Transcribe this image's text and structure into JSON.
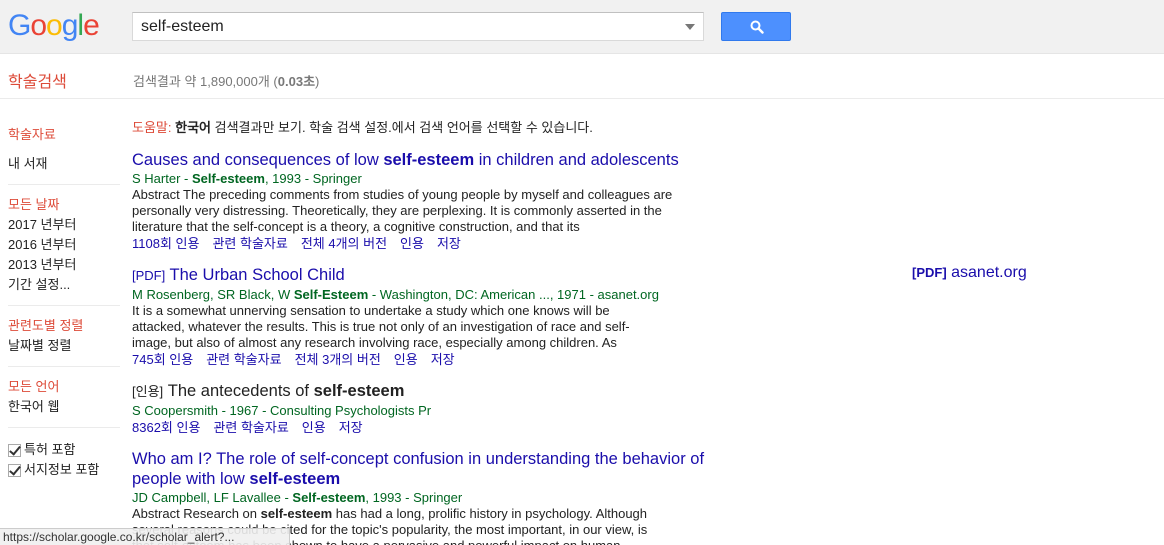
{
  "logo": {
    "letters": [
      {
        "ch": "G",
        "color": "#4285f4"
      },
      {
        "ch": "o",
        "color": "#ea4335"
      },
      {
        "ch": "o",
        "color": "#fbbc05"
      },
      {
        "ch": "g",
        "color": "#4285f4"
      },
      {
        "ch": "l",
        "color": "#34a853"
      },
      {
        "ch": "e",
        "color": "#ea4335"
      }
    ]
  },
  "search": {
    "value": "self-esteem",
    "button_icon": "search-icon"
  },
  "header": {
    "scholar_title": "학술검색",
    "stats_prefix": "검색결과 약 1,890,000개 (",
    "stats_time": "0.03초",
    "stats_suffix": ")"
  },
  "sidebar": {
    "articles": "학술자료",
    "my_library": "내 서재",
    "any_time": "모든 날짜",
    "since_2017": "2017 년부터",
    "since_2016": "2016 년부터",
    "since_2013": "2013 년부터",
    "custom_range": "기간 설정...",
    "sort_relevance": "관련도별 정렬",
    "sort_date": "날짜별 정렬",
    "any_language": "모든 언어",
    "korean_web": "한국어 웹",
    "include_patents": "특허 포함",
    "include_citations": "서지정보 포함"
  },
  "help": {
    "label": "도움말:",
    "lang": "한국어",
    "text": " 검색결과만 보기. 학술 검색 설정.에서 검색 언어를 선택할 수 있습니다."
  },
  "results": [
    {
      "title_pre": "Causes and consequences of low ",
      "title_bold": "self-esteem",
      "title_post": " in children and adolescents",
      "meta_pre": "S Harter - ",
      "meta_bold": "Self-esteem",
      "meta_post": ", 1993 - Springer",
      "snippet": "Abstract The preceding comments from studies of young people by myself and colleagues are personally very distressing. Theoretically, they are perplexing. It is commonly asserted in the literature that the self-concept is a theory, a cognitive construction, and that its",
      "cited": "1108회 인용",
      "related": "관련 학술자료",
      "versions": "전체 4개의 버전",
      "cite": "인용",
      "save": "저장"
    },
    {
      "tag": "[PDF]",
      "title": "The Urban School Child",
      "meta_pre": "M Rosenberg, SR Black, W ",
      "meta_bold": "Self-Esteem",
      "meta_post": " - Washington, DC: American ..., 1971 - asanet.org",
      "snippet": "It is a somewhat unnerving sensation to undertake a study which one knows will be attacked, whatever the results. This is true not only of an investigation of race and self-image, but also of almost any research involving race, especially among children. As",
      "cited": "745회 인용",
      "related": "관련 학술자료",
      "versions": "전체 3개의 버전",
      "cite": "인용",
      "save": "저장",
      "side_tag": "[PDF]",
      "side_domain": "asanet.org"
    },
    {
      "tag": "[인용]",
      "title_pre": "The antecedents of ",
      "title_bold": "self-esteem",
      "meta": "S Coopersmith - 1967 - Consulting Psychologists Pr",
      "cited": "8362회 인용",
      "related": "관련 학술자료",
      "cite": "인용",
      "save": "저장"
    },
    {
      "title_pre": "Who am I? The role of self-concept confusion in understanding the behavior of people with low ",
      "title_bold": "self-esteem",
      "meta_pre": "JD Campbell, LF Lavallee - ",
      "meta_bold": "Self-esteem",
      "meta_post": ", 1993 - Springer",
      "snippet_pre": "Abstract Research on ",
      "snippet_bold": "self-esteem",
      "snippet_post": " has had a long, prolific history in psychology. Although several reasons could be cited for the topic's popularity, the most important, in our view, is that self-esteem has been shown to have a pervasive and powerful impact on human"
    }
  ],
  "status_bar": "https://scholar.google.co.kr/scholar_alert?..."
}
